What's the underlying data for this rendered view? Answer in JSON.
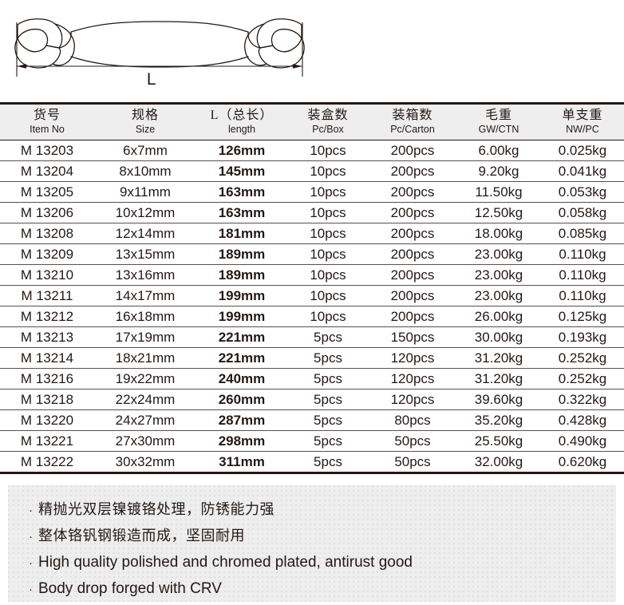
{
  "illustration": {
    "dimension_label": "L",
    "product_icon": "open-end-wrench-outline"
  },
  "table": {
    "headers": [
      {
        "cn": "货号",
        "en": "Item No"
      },
      {
        "cn": "规格",
        "en": "Size"
      },
      {
        "cn": "L（总长）",
        "en": "length"
      },
      {
        "cn": "装盒数",
        "en": "Pc/Box"
      },
      {
        "cn": "装箱数",
        "en": "Pc/Carton"
      },
      {
        "cn": "毛重",
        "en": "GW/CTN"
      },
      {
        "cn": "单支重",
        "en": "NW/PC"
      }
    ],
    "rows": [
      {
        "item": "M 13203",
        "size": "6x7mm",
        "length": "126mm",
        "box": "10pcs",
        "carton": "200pcs",
        "gw": "6.00kg",
        "nw": "0.025kg"
      },
      {
        "item": "M 13204",
        "size": "8x10mm",
        "length": "145mm",
        "box": "10pcs",
        "carton": "200pcs",
        "gw": "9.20kg",
        "nw": "0.041kg"
      },
      {
        "item": "M 13205",
        "size": "9x11mm",
        "length": "163mm",
        "box": "10pcs",
        "carton": "200pcs",
        "gw": "11.50kg",
        "nw": "0.053kg"
      },
      {
        "item": "M 13206",
        "size": "10x12mm",
        "length": "163mm",
        "box": "10pcs",
        "carton": "200pcs",
        "gw": "12.50kg",
        "nw": "0.058kg"
      },
      {
        "item": "M 13208",
        "size": "12x14mm",
        "length": "181mm",
        "box": "10pcs",
        "carton": "200pcs",
        "gw": "18.00kg",
        "nw": "0.085kg"
      },
      {
        "item": "M 13209",
        "size": "13x15mm",
        "length": "189mm",
        "box": "10pcs",
        "carton": "200pcs",
        "gw": "23.00kg",
        "nw": "0.110kg"
      },
      {
        "item": "M 13210",
        "size": "13x16mm",
        "length": "189mm",
        "box": "10pcs",
        "carton": "200pcs",
        "gw": "23.00kg",
        "nw": "0.110kg"
      },
      {
        "item": "M 13211",
        "size": "14x17mm",
        "length": "199mm",
        "box": "10pcs",
        "carton": "200pcs",
        "gw": "23.00kg",
        "nw": "0.110kg"
      },
      {
        "item": "M 13212",
        "size": "16x18mm",
        "length": "199mm",
        "box": "10pcs",
        "carton": "200pcs",
        "gw": "26.00kg",
        "nw": "0.125kg"
      },
      {
        "item": "M 13213",
        "size": "17x19mm",
        "length": "221mm",
        "box": "5pcs",
        "carton": "150pcs",
        "gw": "30.00kg",
        "nw": "0.193kg"
      },
      {
        "item": "M 13214",
        "size": "18x21mm",
        "length": "221mm",
        "box": "5pcs",
        "carton": "120pcs",
        "gw": "31.20kg",
        "nw": "0.252kg"
      },
      {
        "item": "M 13216",
        "size": "19x22mm",
        "length": "240mm",
        "box": "5pcs",
        "carton": "120pcs",
        "gw": "31.20kg",
        "nw": "0.252kg"
      },
      {
        "item": "M 13218",
        "size": "22x24mm",
        "length": "260mm",
        "box": "5pcs",
        "carton": "120pcs",
        "gw": "39.60kg",
        "nw": "0.322kg"
      },
      {
        "item": "M 13220",
        "size": "24x27mm",
        "length": "287mm",
        "box": "5pcs",
        "carton": "80pcs",
        "gw": "35.20kg",
        "nw": "0.428kg"
      },
      {
        "item": "M 13221",
        "size": "27x30mm",
        "length": "298mm",
        "box": "5pcs",
        "carton": "50pcs",
        "gw": "25.50kg",
        "nw": "0.490kg"
      },
      {
        "item": "M 13222",
        "size": "30x32mm",
        "length": "311mm",
        "box": "5pcs",
        "carton": "50pcs",
        "gw": "32.00kg",
        "nw": "0.620kg"
      }
    ]
  },
  "features": {
    "bullet": "·",
    "items": [
      {
        "text": "精抛光双层镍镀铬处理，防锈能力强",
        "lang": "cn"
      },
      {
        "text": "整体铬钒钢锻造而成，坚固耐用",
        "lang": "cn"
      },
      {
        "text": "High quality polished and chromed plated, antirust good",
        "lang": "en"
      },
      {
        "text": "Body drop forged with CRV",
        "lang": "en"
      }
    ]
  },
  "colors": {
    "text": "#231815",
    "header_bg": "#eeeeee",
    "panel_bg": "#eeeeee",
    "rule": "#555150"
  }
}
